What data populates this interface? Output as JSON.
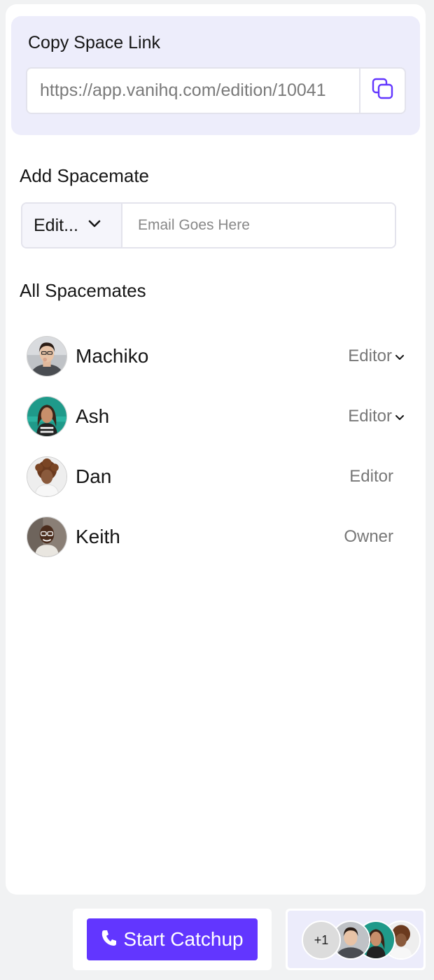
{
  "copy_link": {
    "title": "Copy Space Link",
    "url": "https://app.vanihq.com/edition/10041"
  },
  "add_spacemate": {
    "title": "Add Spacemate",
    "role_selected": "Edit...",
    "email_placeholder": "Email Goes Here"
  },
  "all_spacemates": {
    "title": "All Spacemates",
    "members": [
      {
        "name": "Machiko",
        "role": "Editor",
        "has_dropdown": true
      },
      {
        "name": "Ash",
        "role": "Editor",
        "has_dropdown": true
      },
      {
        "name": "Dan",
        "role": "Editor",
        "has_dropdown": false
      },
      {
        "name": "Keith",
        "role": "Owner",
        "has_dropdown": false
      }
    ]
  },
  "footer": {
    "start_button": "Start Catchup",
    "extra_count": "+1"
  },
  "colors": {
    "accent": "#6236ff",
    "copy_box_bg": "#ededfb",
    "copy_icon": "#6236ff"
  }
}
